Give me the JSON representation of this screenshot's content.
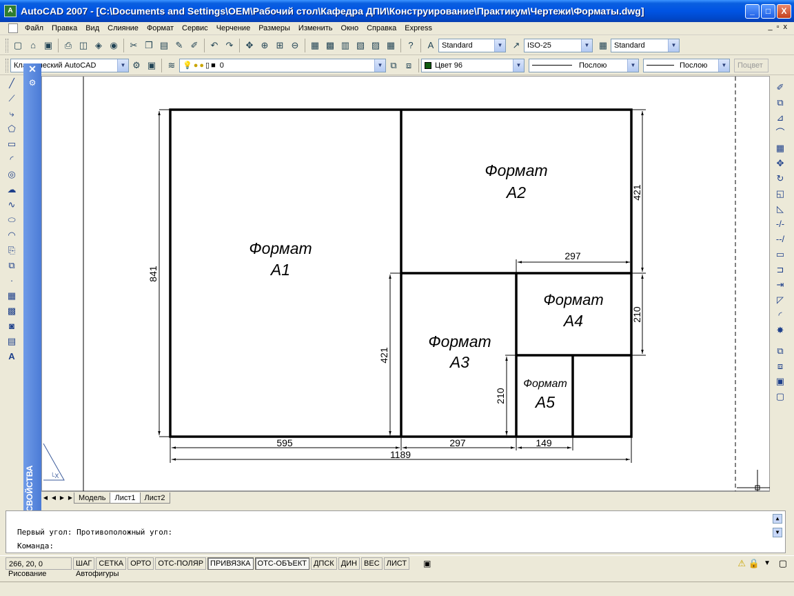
{
  "window": {
    "title": "AutoCAD 2007 - [C:\\Documents and Settings\\OEM\\Рабочий стол\\Кафедра ДПИ\\Конструирование\\Практикум\\Чертежи\\Форматы.dwg]",
    "buttons": [
      "_",
      "□",
      "X"
    ]
  },
  "menu": {
    "items": [
      "Файл",
      "Правка",
      "Вид",
      "Слияние",
      "Формат",
      "Сервис",
      "Черчение",
      "Размеры",
      "Изменить",
      "Окно",
      "Справка",
      "Express"
    ],
    "mdi_buttons": [
      "_",
      "▫",
      "x"
    ]
  },
  "toolbar1": {
    "text_style": "Standard",
    "dim_style": "ISO-25",
    "table_style": "Standard"
  },
  "toolbar2": {
    "workspace": "Классический AutoCAD",
    "layer": "0",
    "color": "Цвет 96",
    "linetype": "Послою",
    "lineweight": "Послою",
    "plot_style": "Поцвет"
  },
  "properties_palette": {
    "label": "СВОЙСТВА"
  },
  "drawing": {
    "formats": [
      {
        "line1": "Формат",
        "line2": "А1"
      },
      {
        "line1": "Формат",
        "line2": "А2"
      },
      {
        "line1": "Формат",
        "line2": "А3"
      },
      {
        "line1": "Формат",
        "line2": "А4"
      },
      {
        "line1": "Формат",
        "line2": "А5"
      }
    ],
    "dimensions": {
      "d841": "841",
      "d421_right": "421",
      "d421_mid": "421",
      "d210_right": "210",
      "d210_mid": "210",
      "d297_top": "297",
      "d595": "595",
      "d297_bottom": "297",
      "d149": "149",
      "d1189": "1189"
    }
  },
  "tabs": {
    "items": [
      "Модель",
      "Лист1",
      "Лист2"
    ],
    "active": "Лист1"
  },
  "command": {
    "line1": "Первый угол: Противоположный угол:",
    "line2": "Команда:"
  },
  "status": {
    "coords": "266, 20, 0",
    "buttons": [
      {
        "label": "ШАГ",
        "on": false
      },
      {
        "label": "СЕТКА",
        "on": false
      },
      {
        "label": "ОРТО",
        "on": false
      },
      {
        "label": "ОТС-ПОЛЯР",
        "on": false
      },
      {
        "label": "ПРИВЯЗКА",
        "on": true
      },
      {
        "label": "ОТС-ОБЪЕКТ",
        "on": true
      },
      {
        "label": "ДПСК",
        "on": false
      },
      {
        "label": "ДИН",
        "on": false
      },
      {
        "label": "ВЕС",
        "on": false
      },
      {
        "label": "ЛИСТ",
        "on": false
      }
    ]
  },
  "bottom_toolbar": {
    "draw_label": "Рисование",
    "shapes_label": "Автофигуры"
  }
}
